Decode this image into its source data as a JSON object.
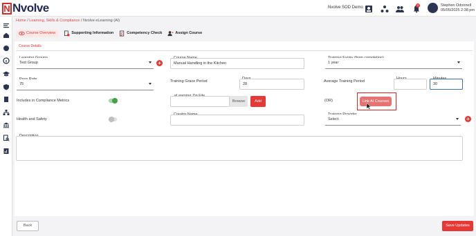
{
  "app": {
    "logo_letter": "N",
    "logo_text": "Nvolve"
  },
  "header": {
    "tenant": "Nvolve SOD Demo",
    "notification_count": "0",
    "user_name": "Stephen Odonnell",
    "datetime": "05/05/2025 2:38 pm"
  },
  "breadcrumb": {
    "home": "Home",
    "sep1": "/",
    "section": "Learning, Skills & Compliance",
    "sep2": "/",
    "current": "Nvolve eLearning (AI)"
  },
  "tabs": [
    {
      "label": "Course Overview"
    },
    {
      "label": "Supporting Information"
    },
    {
      "label": "Competency Check"
    },
    {
      "label": "Assign Course"
    }
  ],
  "form": {
    "section_title": "Course Details",
    "learning_groups": {
      "label": "Learning Groups",
      "value": "Test Group"
    },
    "course_name": {
      "label": "Course Name",
      "value": "Manual Handling in the Kitchen"
    },
    "training_expiry": {
      "label": "Training Expiry (from completion)",
      "value": "1 year"
    },
    "pass_rate": {
      "label": "Pass Rate",
      "value": "75"
    },
    "grace_period": {
      "label": "Training Grace Period",
      "days_label": "Days",
      "days_value": "28"
    },
    "avg_training": {
      "label": "Average Training Period",
      "hours_label": "Hours",
      "hours_value": "",
      "minutes_label": "Minutes",
      "minutes_value": "30"
    },
    "compliance_metrics": {
      "label": "Includes in Compliance Metrics",
      "on": true
    },
    "elearning_zip": {
      "label": "eLearning Zip File",
      "browse": "Browse",
      "add": "Add"
    },
    "or_label": "(OR)",
    "link_ai_button": "Link AI Courses",
    "health_safety": {
      "label": "Health and Safety",
      "on": false
    },
    "creator_name": {
      "label": "Creator Name",
      "value": ""
    },
    "training_provider": {
      "label": "Training Provider",
      "value": "Select"
    },
    "description": {
      "label": "Description",
      "value": ""
    }
  },
  "footer": {
    "back": "Back",
    "save": "Save Updates"
  },
  "colors": {
    "accent": "#e53935",
    "brand_navy": "#1e2a55"
  }
}
